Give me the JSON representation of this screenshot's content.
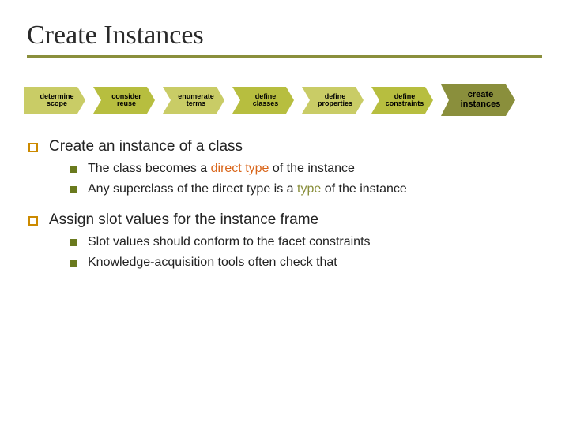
{
  "title": "Create Instances",
  "process": {
    "steps": [
      {
        "label": "determine\nscope"
      },
      {
        "label": "consider\nreuse"
      },
      {
        "label": "enumerate\nterms"
      },
      {
        "label": "define\nclasses"
      },
      {
        "label": "define\nproperties"
      },
      {
        "label": "define\nconstraints"
      }
    ],
    "current": {
      "label": "create\ninstances"
    }
  },
  "b1": {
    "text": "Create an instance of a class",
    "s1a": "The class becomes a ",
    "s1b": "direct type",
    "s1c": " of the instance",
    "s2a": "Any superclass of the direct type is a ",
    "s2b": "type",
    "s2c": " of the instance"
  },
  "b2": {
    "text": "Assign slot values for the instance frame",
    "s1": "Slot values should conform to the facet constraints",
    "s2": "Knowledge-acquisition tools often check that"
  }
}
